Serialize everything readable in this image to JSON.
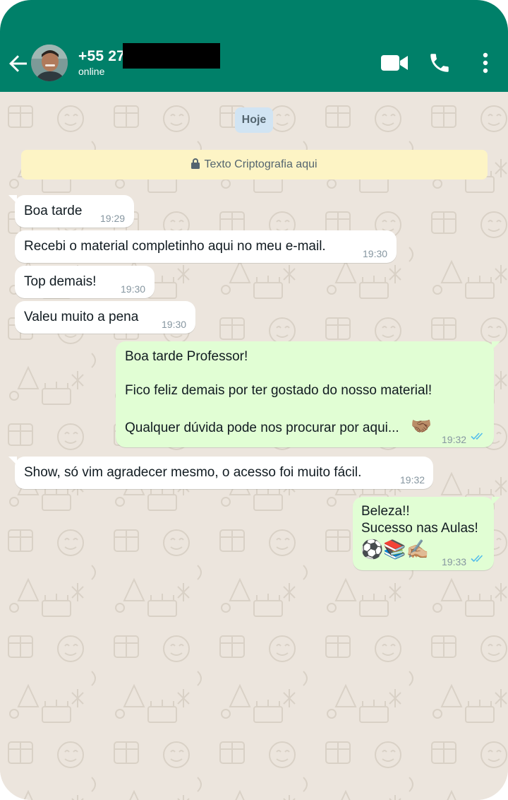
{
  "header": {
    "contact_name": "+55 27",
    "status": "online"
  },
  "chat": {
    "date_chip": "Hoje",
    "encryption_notice": "Texto Criptografia aqui",
    "messages": [
      {
        "direction": "in",
        "text": "Boa tarde",
        "time": "19:29"
      },
      {
        "direction": "in",
        "text": "Recebi o material completinho aqui no meu e-mail.",
        "time": "19:30"
      },
      {
        "direction": "in",
        "text": "Top demais!",
        "time": "19:30"
      },
      {
        "direction": "in",
        "text": "Valeu muito a pena",
        "time": "19:30"
      },
      {
        "direction": "out",
        "line1": "Boa tarde Professor!",
        "line2": "Fico feliz demais por ter gostado do nosso material!",
        "line3": "Qualquer dúvida pode nos procurar por aqui...",
        "emoji": "🤝🏽",
        "time": "19:32",
        "status": "read"
      },
      {
        "direction": "in",
        "text": "Show, só vim agradecer mesmo, o acesso foi muito fácil.",
        "time": "19:32"
      },
      {
        "direction": "out",
        "line1": "Beleza!!",
        "line2": "Sucesso nas Aulas!",
        "emoji": "⚽📚✍🏼",
        "time": "19:33",
        "status": "read"
      }
    ]
  },
  "colors": {
    "header": "#008069",
    "incoming_bubble": "#ffffff",
    "outgoing_bubble": "#e1fed4",
    "read_ticks": "#53bdeb",
    "wallpaper": "#ece5dd"
  },
  "icons": [
    "back-arrow-icon",
    "video-call-icon",
    "phone-call-icon",
    "more-options-icon",
    "lock-icon",
    "double-check-icon"
  ]
}
